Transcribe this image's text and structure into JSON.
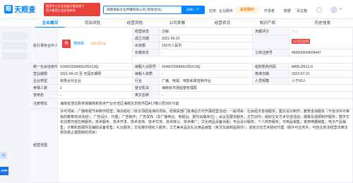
{
  "header": {
    "brand": "天眼查",
    "brand_sub": "TianYanCha.com",
    "promo_line1": "国家中小企业发展子基金旗下",
    "promo_line2": "官方备案企业征信机构",
    "search_value": "海南德泰文化传播有限公司 (有限合伙)",
    "search_button": "天眼一下",
    "app_links": [
      "应用",
      "企业服务"
    ],
    "vip_label": "会员限时",
    "right_links": [
      "开发者",
      "数据",
      "百宝箱"
    ]
  },
  "tabs": [
    {
      "label": "企业概况",
      "badge": "",
      "active": true
    },
    {
      "label": "司法风险",
      "badge": "",
      "active": false
    },
    {
      "label": "经营风险",
      "badge": "",
      "active": false
    },
    {
      "label": "公司发展",
      "badge": "",
      "active": false
    },
    {
      "label": "经营状况",
      "badge": "",
      "active": false
    },
    {
      "label": "知识产权",
      "badge": "",
      "active": false
    },
    {
      "label": "历史信息",
      "badge": "",
      "active": false
    }
  ],
  "profile": {
    "exec_label": "执行事务合伙人",
    "exec_avatar": "杨",
    "exec_name": "杨晓娟",
    "exec_note": "任职1家企业",
    "status_label": "经营状态",
    "status_value": "注销",
    "rating_label": "天眼评分",
    "rating_value": "评分",
    "found_label": "成立日期",
    "found_value": "2021-06-23",
    "report_button": "公司已注销",
    "capital_label": "出资额",
    "capital_value": "100万人民币",
    "paid_label": "实缴资本",
    "paid_value": "-",
    "reg_no_label": "工商注册号",
    "reg_no_value": "460000004028447",
    "credit_label": "统一社会信用代码",
    "credit_value": "91460105MA5U26X19Q",
    "taxpayer_label": "纳税人识别号",
    "taxpayer_value": "91460105MA5U26X19Q",
    "org_label": "组织机构代码",
    "org_value": "MA5U26X1-9",
    "term_label": "营业期限",
    "term_value": "2021-06-23 至 无固定期限",
    "taxpayer_qual_label": "纳税人资质",
    "taxpayer_qual_value": "-",
    "approve_label": "核准日期",
    "approve_value": "2023-07-21",
    "type_label": "企业类型",
    "type_value": "有限合伙企业",
    "industry_label": "行业",
    "industry_value": "广播、电视、电影和录音制作业",
    "staff_label": "人员规模",
    "staff_value": "小于50人",
    "insured_label": "参保人数",
    "insured_value": "1",
    "authority_label": "登记机关",
    "authority_value": "海南省市场监督管理局",
    "former_label": "曾用名",
    "former_value": "-",
    "english_label": "英文名称",
    "english_value": "-",
    "address_label": "注册地址",
    "address_value": "海南省澄迈县老城镇高新技术产业示范区海南生态软件园A17幢三层3007X室",
    "scope_label": "经营范围",
    "scope_value": "许可项目：广播电视节目制作经营；演出经纪（依法须经批准的项目，经相关部门批准后方可开展经营活动）一般项目：社会经济咨询服务；图文设计制作；教育咨询服务（不含涉许可审批的教育培训活动）；广告设计、代理；广告制作；广告发布（非广播电台、电视台、报刊出版单位）；会议及展览服务；文艺创作；组织文化艺术交流活动；摄像及视频制作服务；数字文化创意内容应用服务；技术服务、技术开发、技术咨询、技术交流、技术转让、技术推广；文化用品设备出租；专业设计服务；个人商务服务；日用品销售；家用电器销售；电子产品销售；计算机软硬件及辅助设备零售；礼仪服务；文化娱乐经纪人服务；工艺美术品及礼仪用品销售（象牙及其制品除外）；其他文化艺术经纪代理（除许可业务外，可自主依法经营法律法规非禁止或限制的项目）"
  },
  "colors": {
    "accent": "#0084ff",
    "warning": "#e8423c",
    "orange": "#f0861b"
  }
}
